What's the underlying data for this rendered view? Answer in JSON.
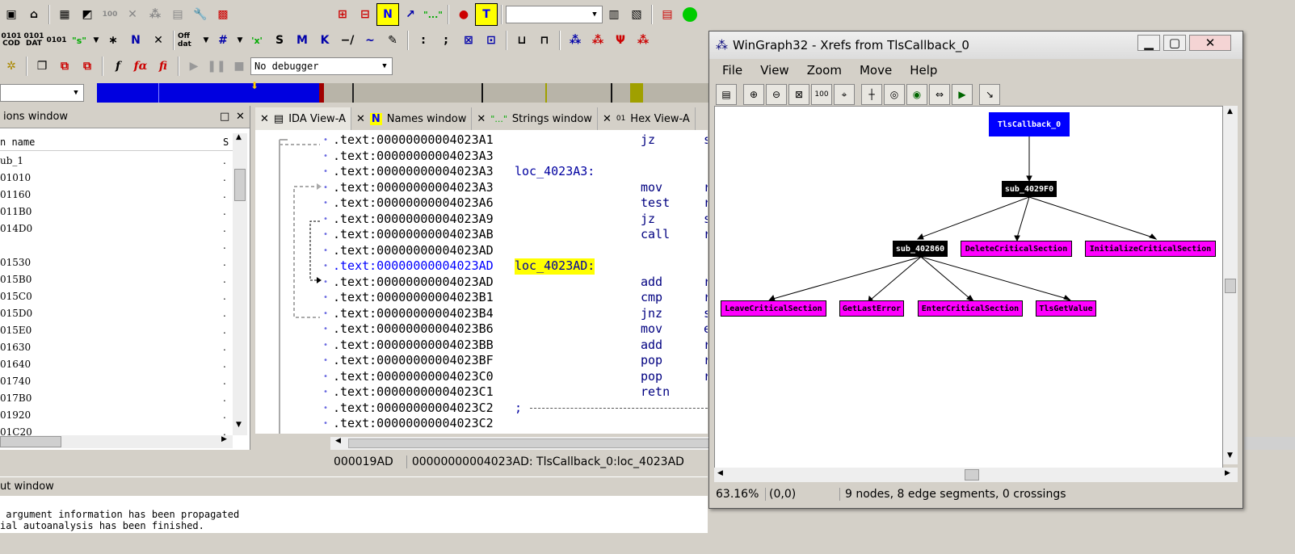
{
  "toolbar": {
    "debugger_select": "No debugger",
    "func_label_1": "0101 COD",
    "func_label_2": "0101 DAT",
    "off_label": "Off dat"
  },
  "functions_window": {
    "title": "ions window",
    "column_name": "n name",
    "column_s": "S",
    "rows": [
      "ub_1",
      "01010",
      "01160",
      "011B0",
      "014D0",
      "",
      "01530",
      "015B0",
      "015C0",
      "015D0",
      "015E0",
      "01630",
      "01640",
      "01740",
      "017B0",
      "01920",
      "01C20"
    ]
  },
  "tabs": [
    {
      "label": "IDA View-A"
    },
    {
      "label": "Names window"
    },
    {
      "label": "Strings window"
    },
    {
      "label": "Hex View-A"
    }
  ],
  "code": [
    {
      "addr": ".text:00000000004023A1",
      "label": "",
      "mnem": "jz",
      "op": "s"
    },
    {
      "addr": ".text:00000000004023A3",
      "label": "",
      "mnem": "",
      "op": ""
    },
    {
      "addr": ".text:00000000004023A3",
      "label": "loc_4023A3:",
      "mnem": "",
      "op": ""
    },
    {
      "addr": ".text:00000000004023A3",
      "label": "",
      "mnem": "mov",
      "op": "r"
    },
    {
      "addr": ".text:00000000004023A6",
      "label": "",
      "mnem": "test",
      "op": "r"
    },
    {
      "addr": ".text:00000000004023A9",
      "label": "",
      "mnem": "jz",
      "op": "s"
    },
    {
      "addr": ".text:00000000004023AB",
      "label": "",
      "mnem": "call",
      "op": "r"
    },
    {
      "addr": ".text:00000000004023AD",
      "label": "",
      "mnem": "",
      "op": ""
    },
    {
      "addr": ".text:00000000004023AD",
      "label": "loc_4023AD:",
      "mnem": "",
      "op": ""
    },
    {
      "addr": ".text:00000000004023AD",
      "label": "",
      "mnem": "add",
      "op": "r"
    },
    {
      "addr": ".text:00000000004023B1",
      "label": "",
      "mnem": "cmp",
      "op": "r"
    },
    {
      "addr": ".text:00000000004023B4",
      "label": "",
      "mnem": "jnz",
      "op": "s"
    },
    {
      "addr": ".text:00000000004023B6",
      "label": "",
      "mnem": "mov",
      "op": "e"
    },
    {
      "addr": ".text:00000000004023BB",
      "label": "",
      "mnem": "add",
      "op": "r"
    },
    {
      "addr": ".text:00000000004023BF",
      "label": "",
      "mnem": "pop",
      "op": "r"
    },
    {
      "addr": ".text:00000000004023C0",
      "label": "",
      "mnem": "pop",
      "op": "r"
    },
    {
      "addr": ".text:00000000004023C1",
      "label": "",
      "mnem": "retn",
      "op": ""
    },
    {
      "addr": ".text:00000000004023C2",
      "label": ";",
      "mnem": "",
      "op": ""
    },
    {
      "addr": ".text:00000000004023C2",
      "label": "",
      "mnem": "",
      "op": ""
    }
  ],
  "status_bar": {
    "offset": "000019AD",
    "location": "00000000004023AD: TlsCallback_0:loc_4023AD"
  },
  "output_window": {
    "title": "ut window",
    "lines": [
      " argument information has been propagated",
      "ial autoanalysis has been finished."
    ]
  },
  "wingraph": {
    "title": "WinGraph32 - Xrefs from TlsCallback_0",
    "menu": [
      "File",
      "View",
      "Zoom",
      "Move",
      "Help"
    ],
    "zoom": "63.16%",
    "coords": "(0,0)",
    "stats": "9 nodes, 8 edge segments, 0 crossings",
    "nodes": {
      "root": "TlsCallback_0",
      "n1": "sub_4029F0",
      "n2": "sub_402860",
      "n3": "DeleteCriticalSection",
      "n4": "InitializeCriticalSection",
      "n5": "LeaveCriticalSection",
      "n6": "GetLastError",
      "n7": "EnterCriticalSection",
      "n8": "TlsGetValue"
    }
  }
}
